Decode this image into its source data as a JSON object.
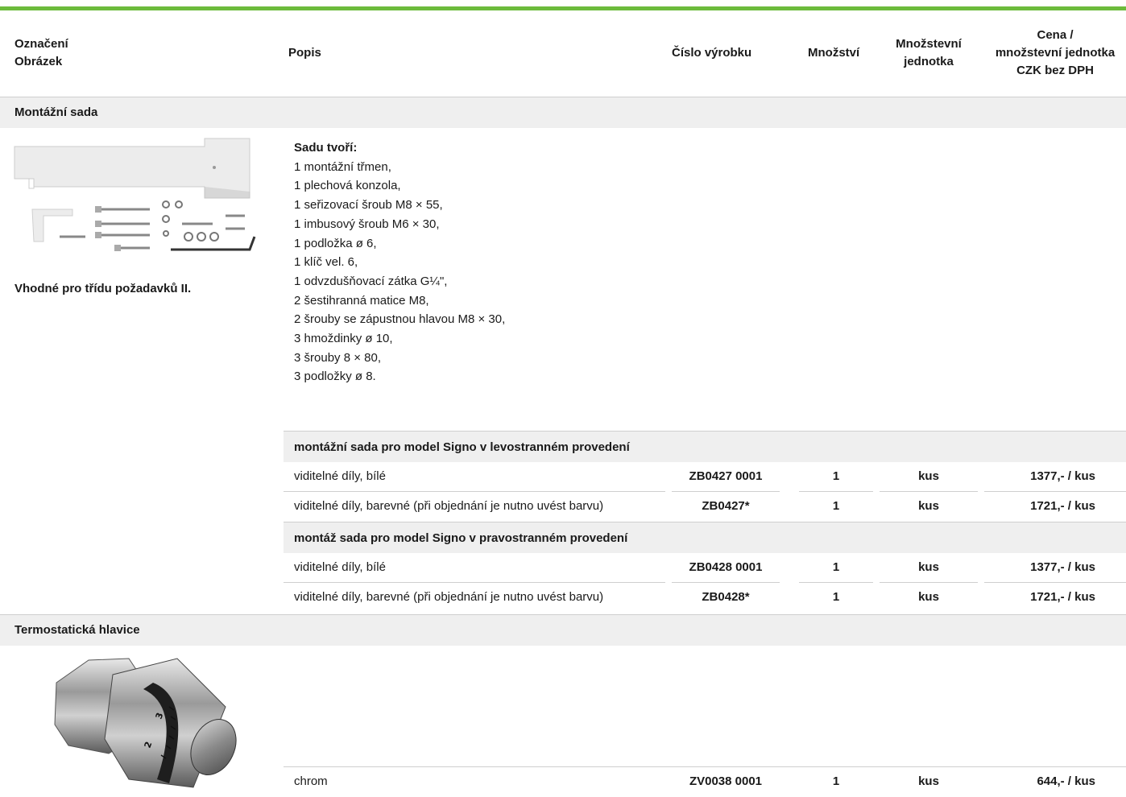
{
  "header": {
    "col1": [
      "Označení",
      "Obrázek"
    ],
    "col2": "Popis",
    "col3": "Číslo výrobku",
    "col4": "Množství",
    "col5": [
      "Množstevní",
      "jednotka"
    ],
    "col6": [
      "Cena /",
      "množstevní jednotka",
      "CZK bez DPH"
    ]
  },
  "sections": {
    "mount": {
      "title": "Montážní sada",
      "note": "Vhodné pro třídu požadavků II.",
      "desc_title": "Sadu tvoří:",
      "desc_lines": [
        "1 montážní třmen,",
        "1 plechová konzola,",
        "1 seřizovací šroub M8 × 55,",
        "1 imbusový šroub M6 × 30,",
        "1 podložka ø 6,",
        "1 klíč vel. 6,",
        "1 odvzdušňovací zátka G¼\",",
        "2 šestihranná matice M8,",
        "2 šrouby se zápustnou hlavou M8 × 30,",
        "3 hmoždinky ø 10,",
        "3 šrouby 8 × 80,",
        "3 podložky ø 8."
      ],
      "groups": [
        {
          "title": "montážní sada pro model Signo v levostranném provedení",
          "rows": [
            {
              "desc": "viditelné díly, bílé",
              "code": "ZB0427 0001",
              "qty": "1",
              "unit": "kus",
              "price": "1377,- / kus"
            },
            {
              "desc": "viditelné díly, barevné (při objednání je nutno uvést barvu)",
              "code": "ZB0427*",
              "qty": "1",
              "unit": "kus",
              "price": "1721,- / kus"
            }
          ]
        },
        {
          "title": "montáž sada pro model Signo v pravostranném provedení",
          "rows": [
            {
              "desc": "viditelné díly, bílé",
              "code": "ZB0428 0001",
              "qty": "1",
              "unit": "kus",
              "price": "1377,- / kus"
            },
            {
              "desc": "viditelné díly, barevné (při objednání je nutno uvést barvu)",
              "code": "ZB0428*",
              "qty": "1",
              "unit": "kus",
              "price": "1721,- / kus"
            }
          ]
        }
      ]
    },
    "thermo": {
      "title": "Termostatická hlavice",
      "dial_marks": [
        "2",
        "3"
      ],
      "rows": [
        {
          "desc": "chrom",
          "code": "ZV0038 0001",
          "qty": "1",
          "unit": "kus",
          "price": "644,- / kus"
        }
      ]
    }
  },
  "colors": {
    "accent": "#6cbb3c",
    "band": "#efefef",
    "rule": "#cfcfcf"
  }
}
